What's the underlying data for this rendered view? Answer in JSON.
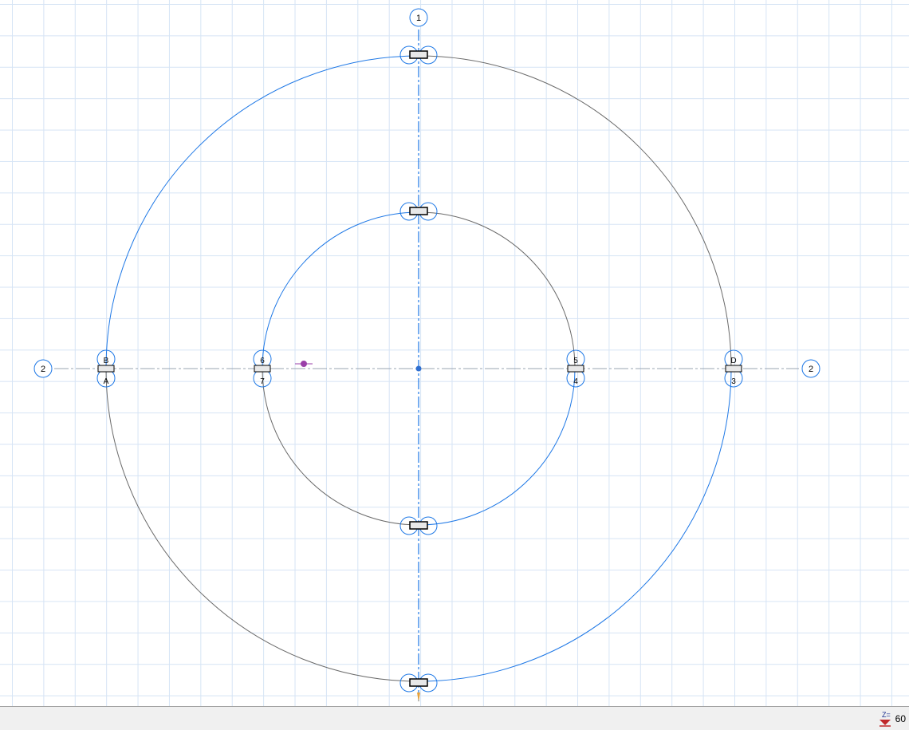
{
  "grid_bubbles": {
    "top": "1",
    "left": "2",
    "right": "2"
  },
  "tag_letters": {
    "left_upper": "B",
    "left_lower": "A",
    "right_upper": "D",
    "right_lower": "3",
    "inner_left_upper": "6",
    "inner_left_lower": "7",
    "inner_right_upper": "5",
    "inner_right_lower": "4"
  },
  "statusbar": {
    "z_label": "Z=",
    "z_value": "60"
  },
  "colors": {
    "selected": "#1e78e6",
    "unselected": "#6a6a6a",
    "grid": "#d6e4f5",
    "point": "#9a3fa8"
  }
}
